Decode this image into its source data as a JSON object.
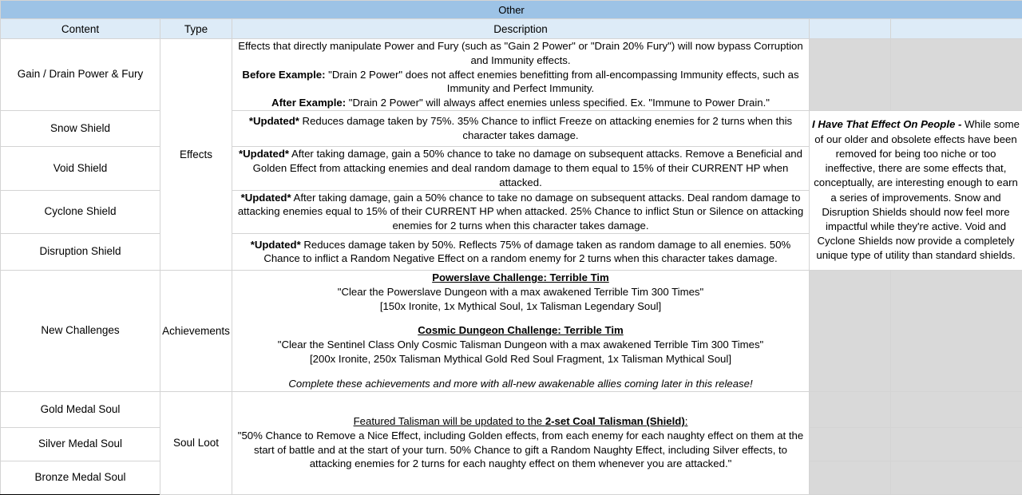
{
  "sheet": {
    "title": "Other",
    "columns": {
      "content": "Content",
      "type": "Type",
      "description": "Description",
      "extra1": "",
      "extra2": ""
    }
  },
  "rows": [
    {
      "content": "Gain / Drain Power & Fury",
      "type": "Effects",
      "description_lines": [
        {
          "text": "Effects that directly manipulate Power and Fury (such as \"Gain 2 Power\" or \"Drain 20% Fury\") will now bypass Corruption and Immunity effects.",
          "style": "normal"
        },
        {
          "label": "Before Example:",
          "text": " \"Drain 2 Power\" does not affect enemies benefitting from all-encompassing Immunity effects, such as Immunity and Perfect Immunity.",
          "style": "label"
        },
        {
          "label": "After Example:",
          "text": " \"Drain 2 Power\" will always affect enemies unless specified. Ex. \"Immune to Power Drain.\"",
          "style": "label"
        }
      ]
    },
    {
      "content": "Snow Shield",
      "type": "",
      "description_lines": [
        {
          "label": "*Updated*",
          "text": " Reduces damage taken by 75%. 35% Chance to inflict Freeze on attacking enemies for 2 turns when this character takes damage.",
          "style": "label"
        }
      ]
    },
    {
      "content": "Void Shield",
      "type": "",
      "description_lines": [
        {
          "label": "*Updated*",
          "text": " After taking damage, gain a 50% chance to take no damage on subsequent attacks. Remove a Beneficial and Golden Effect from attacking enemies and deal random damage to them equal to 15% of their CURRENT HP when attacked.",
          "style": "label"
        }
      ]
    },
    {
      "content": "Cyclone Shield",
      "type": "",
      "description_lines": [
        {
          "label": "*Updated*",
          "text": " After taking damage, gain a 50% chance to take no damage on subsequent attacks. Deal random damage to attacking enemies equal to 15% of their CURRENT HP when attacked. 25% Chance to inflict Stun or Silence on attacking enemies for 2 turns when this character takes damage.",
          "style": "label"
        }
      ]
    },
    {
      "content": "Disruption Shield",
      "type": "",
      "description_lines": [
        {
          "label": "*Updated*",
          "text": " Reduces damage taken by 50%. Reflects 75% of damage taken as random damage to all enemies. 50% Chance to inflict a Random Negative Effect on a random enemy for 2 turns when this character takes damage.",
          "style": "label"
        }
      ]
    },
    {
      "content": "New Challenges",
      "type": "Achievements",
      "description_lines": [
        {
          "text": "Powerslave Challenge: Terrible Tim",
          "style": "heading"
        },
        {
          "text": "\"Clear the Powerslave Dungeon with a max awakened Terrible Tim 300 Times\"",
          "style": "normal"
        },
        {
          "text": "[150x Ironite, 1x Mythical Soul, 1x Talisman Legendary Soul]",
          "style": "normal"
        },
        {
          "text": "",
          "style": "spacer"
        },
        {
          "text": "Cosmic Dungeon Challenge: Terrible Tim",
          "style": "heading"
        },
        {
          "text": "\"Clear the Sentinel Class Only Cosmic Talisman Dungeon with a max awakened Terrible Tim 300 Times\"",
          "style": "normal"
        },
        {
          "text": "[200x Ironite, 250x Talisman Mythical Gold Red Soul Fragment, 1x Talisman Mythical Soul]",
          "style": "normal"
        },
        {
          "text": "",
          "style": "spacer"
        },
        {
          "text": "Complete these achievements and more with all-new awakenable allies coming later in this release!",
          "style": "italic"
        }
      ]
    },
    {
      "content": "Gold Medal Soul",
      "type": "Soul Loot",
      "description_lines": [
        {
          "text": "Featured Talisman will be updated to the ",
          "bold_tail": "2-set Coal Talisman (Shield)",
          "tail": ":",
          "style": "underline-heading"
        },
        {
          "text": "\"50% Chance to Remove a Nice Effect, including Golden effects, from each enemy for each naughty effect on them at the start of battle and at the start of your turn. 50% Chance to gift a Random Naughty Effect, including Silver effects, to attacking enemies for 2 turns for each naughty effect on them whenever you are attacked.\"",
          "style": "normal"
        }
      ]
    },
    {
      "content": "Silver Medal Soul",
      "type": "",
      "description_lines": []
    },
    {
      "content": "Bronze Medal Soul",
      "type": "",
      "description_lines": []
    }
  ],
  "side_note": {
    "title": "I Have That Effect On People -",
    "body": " While some of our older and obsolete effects have been removed for being too niche or too ineffective, there are some effects that, conceptually, are interesting enough to earn a series of improvements. Snow and Disruption Shields should now feel more impactful while they're active. Void and Cyclone Shields now provide a completely unique type of utility than standard shields."
  },
  "colors": {
    "title_band": "#9dc3e6",
    "column_header": "#ddebf7",
    "gray_panel": "#d9d9d9",
    "grid_line": "#d4d4d4",
    "outer_border": "#000000"
  }
}
